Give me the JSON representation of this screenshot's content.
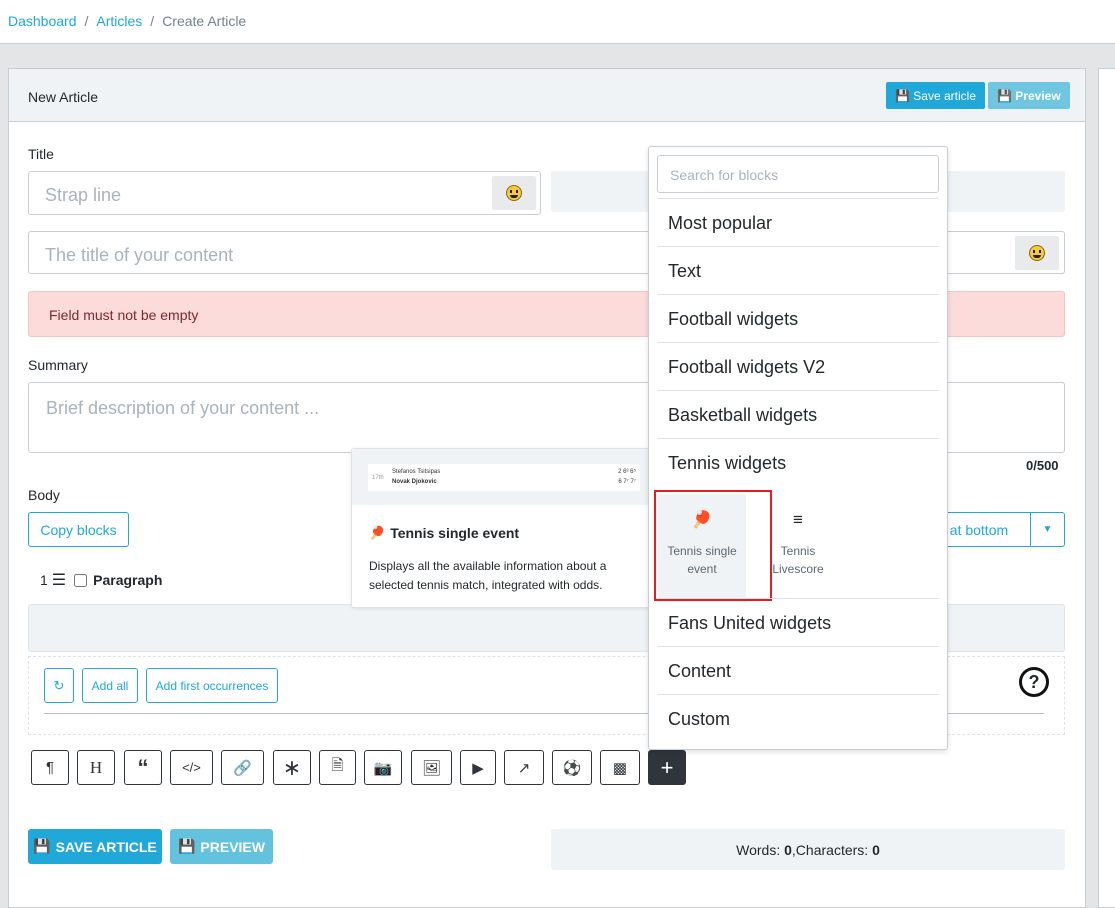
{
  "breadcrumb": {
    "dashboard": "Dashboard",
    "articles": "Articles",
    "current": "Create Article",
    "sep": "/"
  },
  "card": {
    "title": "New Article",
    "save_label": "Save article",
    "preview_label": "Preview"
  },
  "form": {
    "title_label": "Title",
    "strap_placeholder": "Strap line",
    "title_placeholder": "The title of your content",
    "error": "Field must not be empty",
    "summary_label": "Summary",
    "summary_placeholder": "Brief description of your content ...",
    "summary_count": "0/500",
    "body_label": "Body",
    "copy_blocks": "Copy blocks",
    "at_bottom": "t at bottom",
    "block_number": "1",
    "paragraph": "Paragraph",
    "add_all": "Add all",
    "add_first": "Add first occurrences"
  },
  "footer": {
    "save": "SAVE ARTICLE",
    "preview": "PREVIEW",
    "words_label": "Words: ",
    "words": "0",
    "chars_label": ",Characters: ",
    "chars": "0"
  },
  "dropdown": {
    "search_placeholder": "Search for blocks",
    "categories": [
      "Most popular",
      "Text",
      "Football widgets",
      "Football widgets V2",
      "Basketball widgets",
      "Tennis widgets",
      "Fans United widgets",
      "Content",
      "Custom"
    ],
    "tennis_items": [
      {
        "label": "Tennis single event",
        "icon": "tennis-icon",
        "selected": true
      },
      {
        "label": "Tennis Livescore",
        "icon": "bar-list-icon",
        "selected": false
      }
    ]
  },
  "tooltip": {
    "title": "Tennis single event",
    "description": "Displays all the available information about a selected tennis match, integrated with odds.",
    "preview_player1": "Stefanos Tsitsipas",
    "preview_player2": "Novak Djokovic",
    "preview_time": "17th",
    "preview_p1_scores": "2  6³  6⁵",
    "preview_p2_scores": "6  7⁷  7⁷"
  },
  "colors": {
    "primary": "#20a8d8",
    "light": "#63c2de",
    "error_bg": "#fcdbdb",
    "selected_border": "#e02020"
  }
}
